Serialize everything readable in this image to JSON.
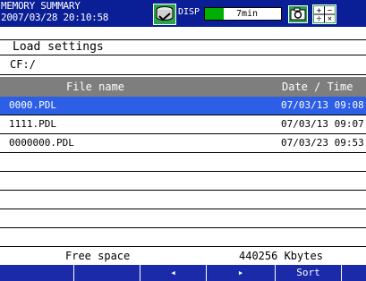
{
  "status": {
    "title": "MEMORY SUMMARY",
    "datetime": "2007/03/28 20:10:58",
    "disp_label": "DISP",
    "disp_time": "7min",
    "disp_fill_fraction": 0.25,
    "icons": [
      "memory-icon",
      "camera-icon",
      "calculator-icon"
    ]
  },
  "page": {
    "title": "Load settings",
    "path": "CF:/"
  },
  "table": {
    "headers": {
      "name": "File name",
      "date": "Date / Time"
    },
    "rows": [
      {
        "name": "0000.PDL",
        "date": "07/03/13 09:08",
        "selected": true
      },
      {
        "name": "1111.PDL",
        "date": "07/03/13 09:07",
        "selected": false
      },
      {
        "name": "0000000.PDL",
        "date": "07/03/23 09:53",
        "selected": false
      },
      {
        "name": "",
        "date": "",
        "selected": false
      },
      {
        "name": "",
        "date": "",
        "selected": false
      },
      {
        "name": "",
        "date": "",
        "selected": false
      },
      {
        "name": "",
        "date": "",
        "selected": false
      },
      {
        "name": "",
        "date": "",
        "selected": false
      }
    ]
  },
  "footer": {
    "free_space_label": "Free space",
    "free_space_value": "440256 Kbytes"
  },
  "softkeys": [
    "",
    "",
    "◂",
    "▸",
    "Sort",
    ""
  ],
  "colors": {
    "statusbar": "#0a1e96",
    "header": "#7e7e7e",
    "selected": "#2c5ee6",
    "softkeys": "#1a2aa8",
    "disp_fill": "#00b000"
  }
}
